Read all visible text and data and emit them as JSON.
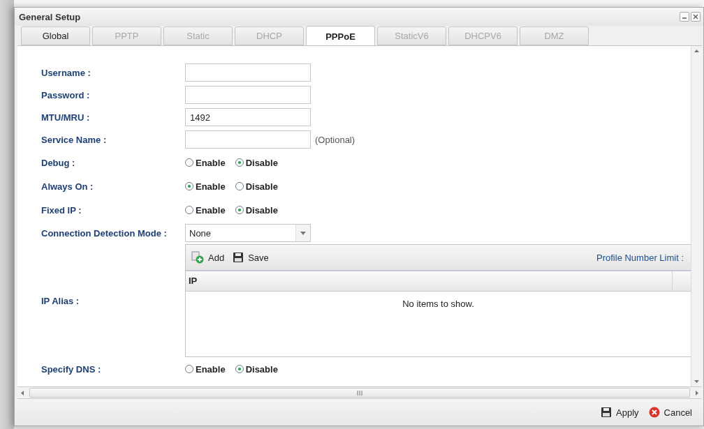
{
  "window": {
    "title": "General Setup"
  },
  "tabs": [
    {
      "label": "Global",
      "selected": false,
      "disabled": false
    },
    {
      "label": "PPTP",
      "selected": false,
      "disabled": true
    },
    {
      "label": "Static",
      "selected": false,
      "disabled": true
    },
    {
      "label": "DHCP",
      "selected": false,
      "disabled": true
    },
    {
      "label": "PPPoE",
      "selected": true,
      "disabled": false
    },
    {
      "label": "StaticV6",
      "selected": false,
      "disabled": true
    },
    {
      "label": "DHCPV6",
      "selected": false,
      "disabled": true
    },
    {
      "label": "DMZ",
      "selected": false,
      "disabled": true
    }
  ],
  "fields": [
    {
      "kind": "text",
      "label": "Username :"
    },
    {
      "kind": "text",
      "label": "Password :"
    },
    {
      "kind": "text",
      "label": "MTU/MRU :",
      "value": "1492"
    },
    {
      "kind": "text",
      "label": "Service Name :",
      "note": "(Optional)"
    },
    {
      "kind": "radio",
      "label": "Debug :",
      "options": [
        {
          "label": "Enable",
          "selected": false
        },
        {
          "label": "Disable",
          "selected": true
        }
      ]
    },
    {
      "kind": "radio",
      "label": "Always On :",
      "options": [
        {
          "label": "Enable",
          "selected": true
        },
        {
          "label": "Disable",
          "selected": false
        }
      ]
    },
    {
      "kind": "radio",
      "label": "Fixed IP :",
      "options": [
        {
          "label": "Enable",
          "selected": false
        },
        {
          "label": "Disable",
          "selected": true
        }
      ]
    },
    {
      "kind": "select",
      "label": "Connection Detection Mode :",
      "value": "None"
    },
    {
      "kind": "grid",
      "label": "IP Alias :",
      "toolbar": [
        {
          "label": "Add"
        },
        {
          "label": "Save"
        }
      ],
      "limit": "Profile Number Limit :",
      "columns": [
        "IP"
      ],
      "empty": "No items to show."
    },
    {
      "kind": "radio",
      "label": "Specify DNS :",
      "options": [
        {
          "label": "Enable",
          "selected": false
        },
        {
          "label": "Disable",
          "selected": true
        }
      ]
    }
  ],
  "footer": [
    {
      "label": "Apply"
    },
    {
      "label": "Cancel"
    }
  ]
}
